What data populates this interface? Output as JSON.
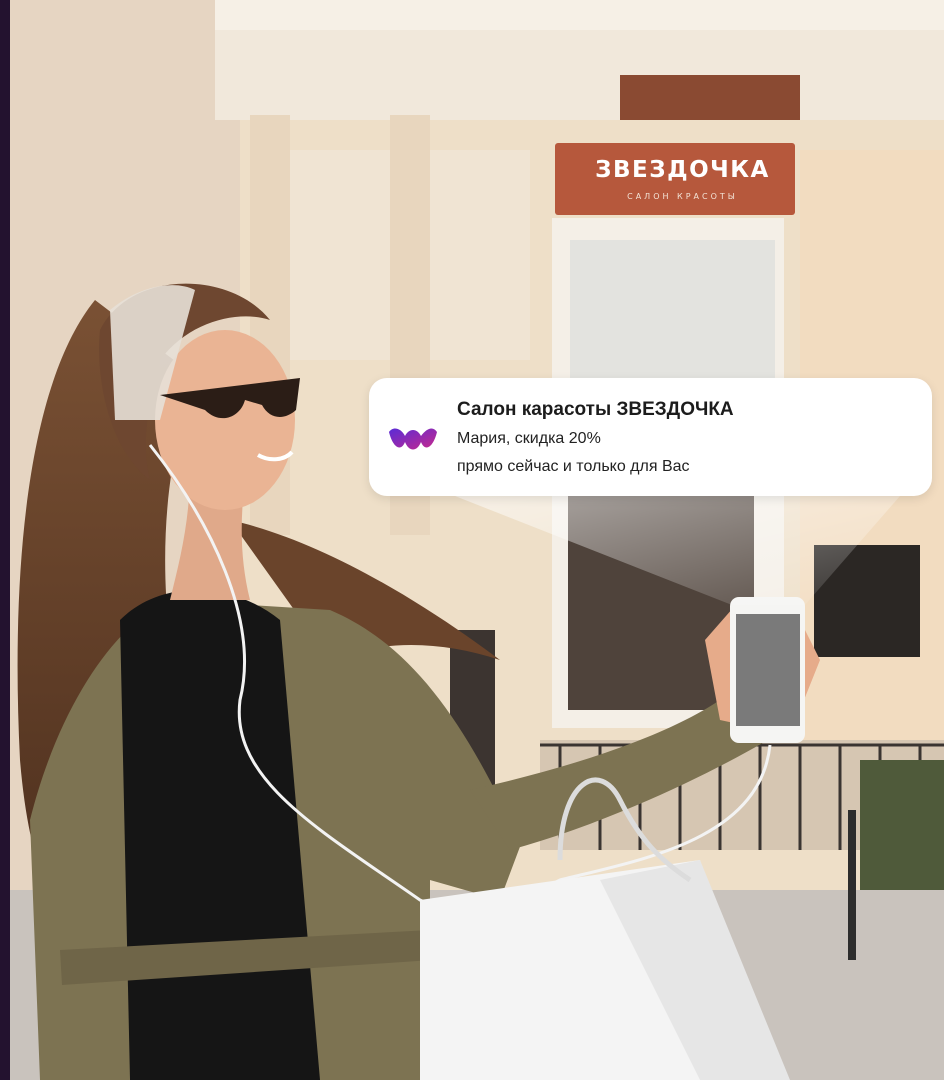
{
  "colors": {
    "edge_strip": "#23122f",
    "sign_background": "#b6583c",
    "notification_background": "#ffffff",
    "logo_gradient_start": "#5b2bd6",
    "logo_gradient_end": "#c72a8c"
  },
  "storefront": {
    "sign_name": "ЗВЕЗДОЧКА",
    "sign_subtitle": "САЛОН КРАСОТЫ"
  },
  "notification": {
    "logo_icon": "app-logo-icon",
    "title": "Салон карасоты ЗВЕЗДОЧКА",
    "line1": "Мария, скидка 20%",
    "line2": "прямо сейчас и только для Вас"
  }
}
